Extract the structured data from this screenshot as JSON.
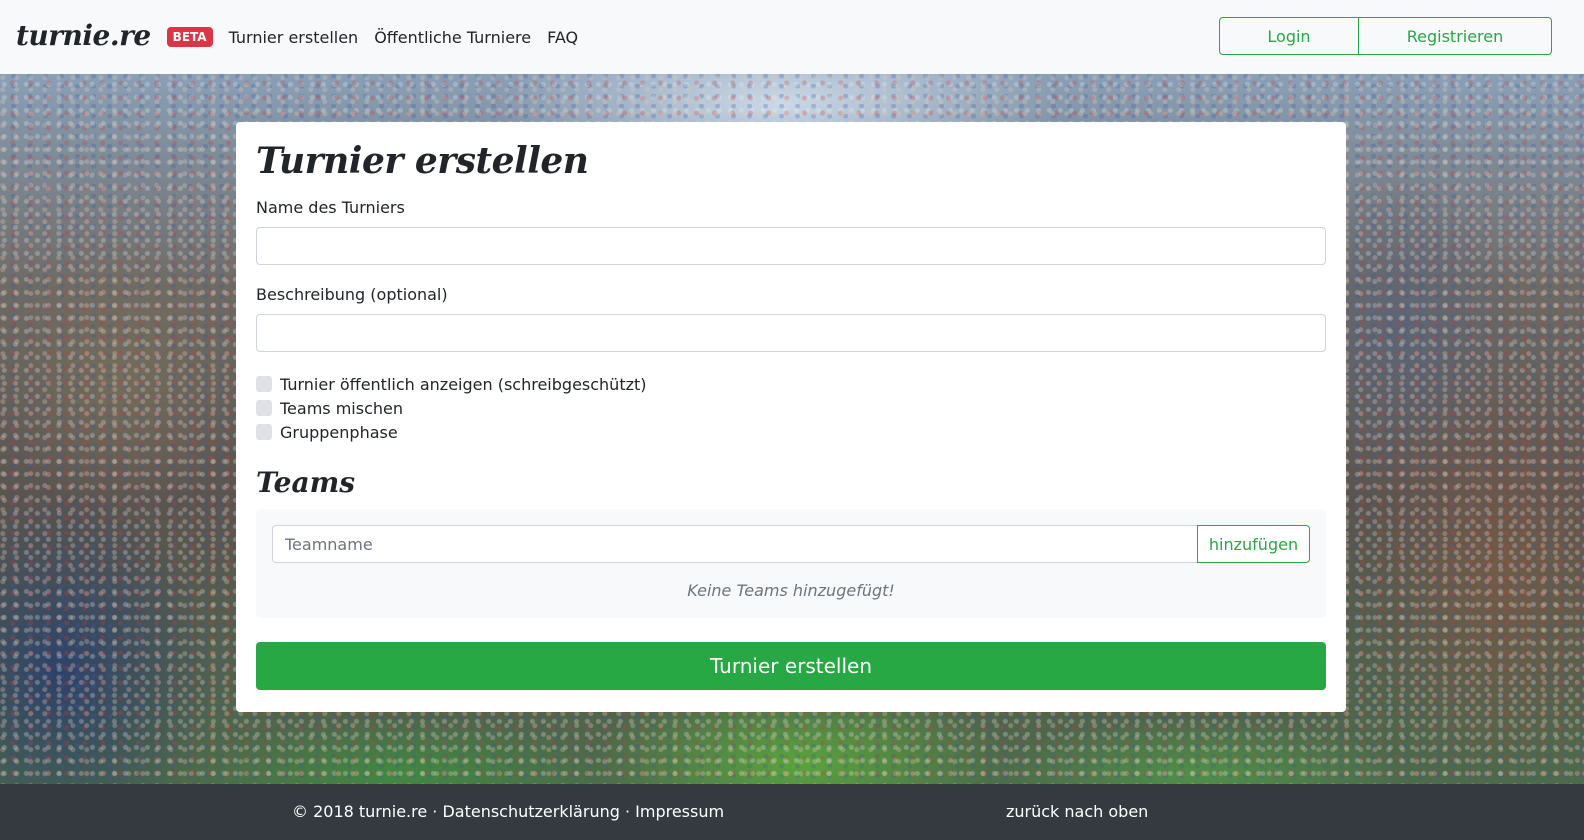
{
  "navbar": {
    "brand": "turnie.re",
    "badge": "BETA",
    "links": [
      "Turnier erstellen",
      "Öffentliche Turniere",
      "FAQ"
    ],
    "login_label": "Login",
    "register_label": "Registrieren"
  },
  "form": {
    "title": "Turnier erstellen",
    "name_label": "Name des Turniers",
    "name_value": "",
    "description_label": "Beschreibung (optional)",
    "description_value": "",
    "checkboxes": [
      {
        "label": "Turnier öffentlich anzeigen (schreibgeschützt)",
        "checked": false
      },
      {
        "label": "Teams mischen",
        "checked": false
      },
      {
        "label": "Gruppenphase",
        "checked": false
      }
    ],
    "teams_title": "Teams",
    "team_placeholder": "Teamname",
    "add_label": "hinzufügen",
    "empty_text": "Keine Teams hinzugefügt!",
    "submit_label": "Turnier erstellen"
  },
  "footer": {
    "copyright": "© 2018 turnie.re",
    "separator": " · ",
    "privacy": "Datenschutzerklärung",
    "imprint": "Impressum",
    "back_to_top": "zurück nach oben"
  },
  "colors": {
    "accent": "#28a745",
    "badge": "#dc3545",
    "footer_bg": "#343a40",
    "navbar_bg": "#f8f9fa"
  }
}
